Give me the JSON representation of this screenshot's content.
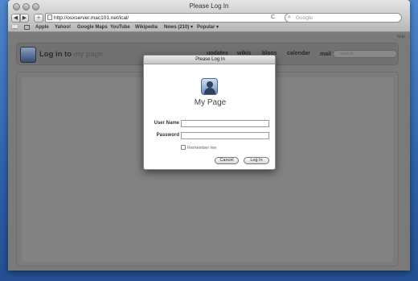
{
  "window": {
    "title": "Please Log In"
  },
  "toolbar": {
    "back": "◀",
    "forward": "▶",
    "add": "+",
    "url": "http://osxserver.mac101.net/ical/",
    "reload": "C",
    "search_placeholder": "Google"
  },
  "bookmarks": [
    "Apple",
    "Yahoo!",
    "Google Maps",
    "YouTube",
    "Wikipedia",
    "News (210) ▾",
    "Popular ▾"
  ],
  "page": {
    "help": "help",
    "title_bold": "Log in to",
    "title_rest": "my page",
    "nav": [
      "updates",
      "wikis",
      "blogs",
      "calendar",
      "mail ▾"
    ],
    "search_placeholder": "search"
  },
  "dialog": {
    "title": "Please Log In",
    "name": "My Page",
    "username_label": "User Name",
    "password_label": "Password",
    "username_value": "",
    "password_value": "",
    "remember_label": "Remember me",
    "cancel_label": "Cancel",
    "login_label": "Log In"
  }
}
